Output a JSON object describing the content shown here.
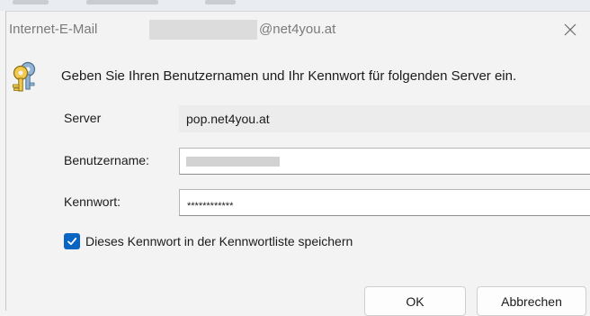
{
  "dialog": {
    "title_prefix": "Internet-E-Mail",
    "title_domain": "@net4you.at",
    "close_icon": "close-icon",
    "key_icon": "keys-icon",
    "prompt": "Geben Sie Ihren Benutzernamen und Ihr Kennwort für folgenden Server ein."
  },
  "form": {
    "server_label": "Server",
    "server_value": "pop.net4you.at",
    "username_label": "Benutzername:",
    "username_value": "",
    "password_label": "Kennwort:",
    "password_value": "************",
    "save_password_label": "Dieses Kennwort in der Kennwortliste speichern",
    "save_password_checked": true
  },
  "buttons": {
    "ok": "OK",
    "cancel": "Abbrechen"
  },
  "colors": {
    "accent": "#0a64c2",
    "background": "#f3f3f3"
  }
}
